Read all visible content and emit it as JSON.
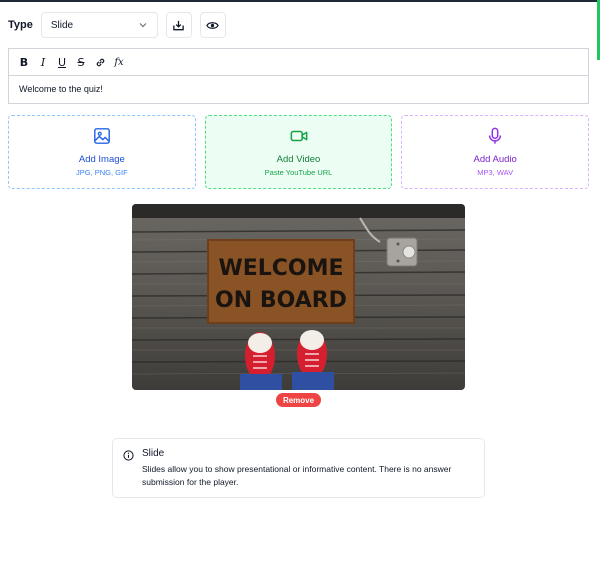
{
  "type_selector": {
    "label": "Type",
    "value": "Slide"
  },
  "header_icons": [
    "download-icon",
    "eye-icon"
  ],
  "editor": {
    "toolbar": [
      {
        "name": "bold",
        "glyph": "B"
      },
      {
        "name": "italic",
        "glyph": "I"
      },
      {
        "name": "underline",
        "glyph": "U"
      },
      {
        "name": "strikethrough",
        "glyph": "S"
      },
      {
        "name": "link",
        "glyph": "link-icon"
      },
      {
        "name": "formula",
        "glyph": "fx"
      }
    ],
    "content": "Welcome to the quiz!"
  },
  "media": {
    "image": {
      "title": "Add Image",
      "subtitle": "JPG, PNG, GIF",
      "color": "#1d4ed8",
      "icon": "image-icon"
    },
    "video": {
      "title": "Add Video",
      "subtitle": "Paste YouTube URL",
      "color": "#15803d",
      "icon": "video-icon"
    },
    "audio": {
      "title": "Add Audio",
      "subtitle": "MP3, WAV",
      "color": "#7e22ce",
      "icon": "microphone-icon"
    }
  },
  "photo": {
    "mat_line1": "WELCOME",
    "mat_line2": "ON BOARD"
  },
  "remove_label": "Remove",
  "info": {
    "title": "Slide",
    "text": "Slides allow you to show presentational or informative content. There is no answer submission for the player."
  },
  "colors": {
    "remove": "#ef4444",
    "accent_green": "#22c55e"
  }
}
